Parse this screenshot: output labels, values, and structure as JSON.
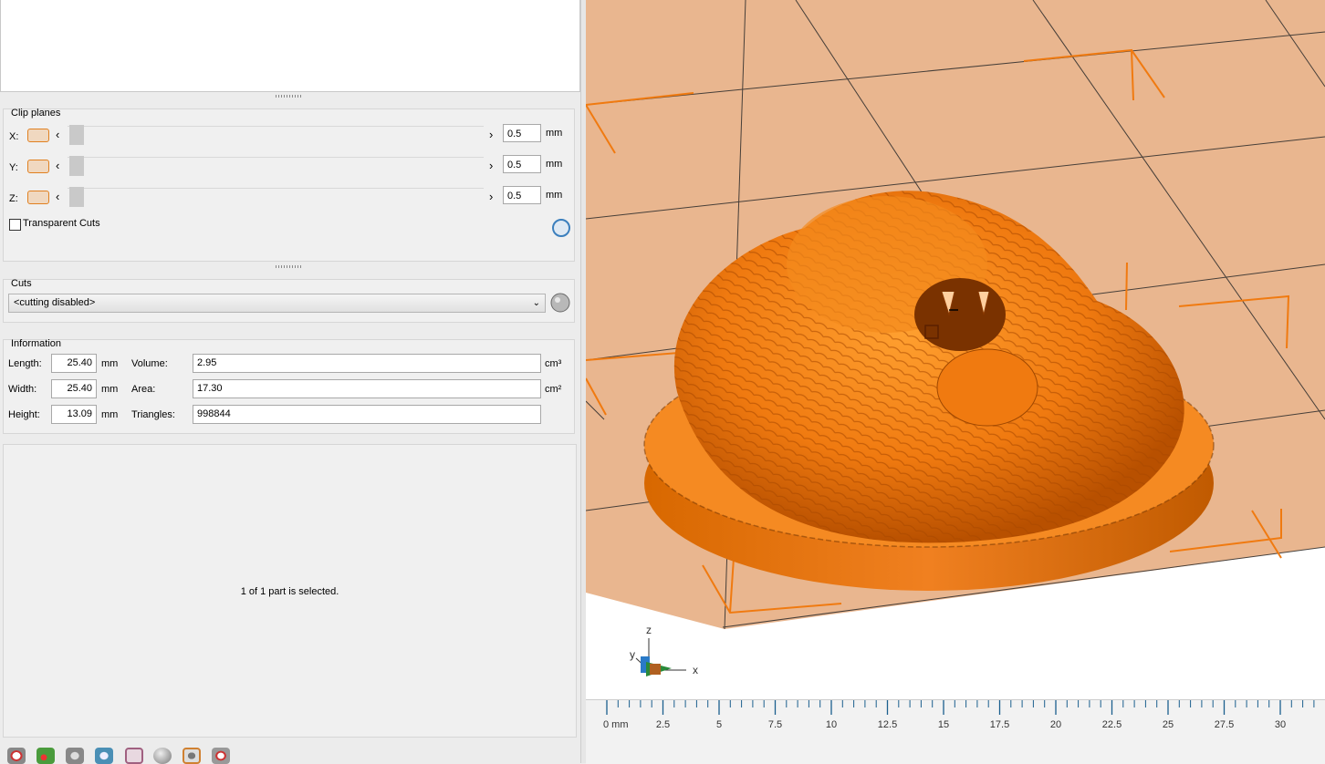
{
  "clip_planes": {
    "title": "Clip planes",
    "rows": [
      {
        "axis": "X:",
        "value": "0.5",
        "unit": "mm"
      },
      {
        "axis": "Y:",
        "value": "0.5",
        "unit": "mm"
      },
      {
        "axis": "Z:",
        "value": "0.5",
        "unit": "mm"
      }
    ],
    "transparent_cuts": "Transparent Cuts"
  },
  "cuts": {
    "title": "Cuts",
    "selected": "<cutting disabled>"
  },
  "information": {
    "title": "Information",
    "length_label": "Length:",
    "length": "25.40",
    "length_unit": "mm",
    "width_label": "Width:",
    "width": "25.40",
    "width_unit": "mm",
    "height_label": "Height:",
    "height": "13.09",
    "height_unit": "mm",
    "volume_label": "Volume:",
    "volume": "2.95",
    "volume_unit": "cm³",
    "area_label": "Area:",
    "area": "17.30",
    "area_unit": "cm²",
    "triangles_label": "Triangles:",
    "triangles": "998844"
  },
  "status": "1 of 1 part is selected.",
  "axes": {
    "x": "x",
    "y": "y",
    "z": "z"
  },
  "ruler": {
    "labels": [
      "0 mm",
      "2.5",
      "5",
      "7.5",
      "10",
      "12.5",
      "15",
      "17.5",
      "20",
      "22.5",
      "25",
      "27.5",
      "30"
    ]
  },
  "colors": {
    "model": "#f07a10",
    "bed": "#e9b68f",
    "accent": "#e08020"
  },
  "toolbar_icons": [
    "add-part-icon",
    "repair-icon",
    "rotate-icon",
    "refresh-icon",
    "frame-icon",
    "sphere-icon",
    "box-select-icon",
    "settings-icon"
  ]
}
